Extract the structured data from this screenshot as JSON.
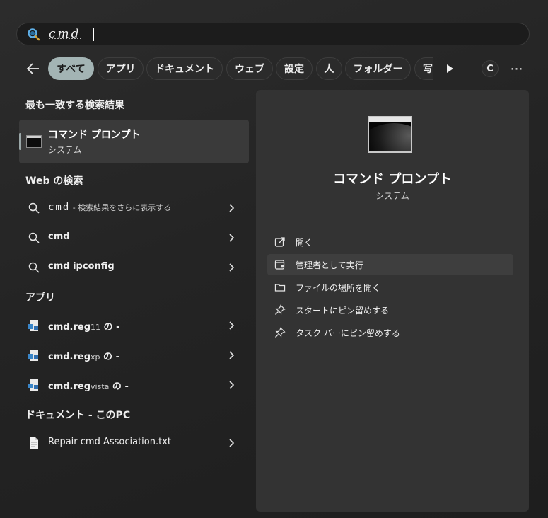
{
  "search": {
    "query": "cmd"
  },
  "filters": {
    "chips": [
      "すべて",
      "アプリ",
      "ドキュメント",
      "ウェブ",
      "設定",
      "人",
      "フォルダー",
      "写"
    ],
    "avatar_initial": "C",
    "more_label": "⋯"
  },
  "best_match": {
    "heading": "最も一致する検索結果",
    "title": "コマンド プロンプト",
    "subtitle": "システム"
  },
  "web": {
    "heading": "Web の検索",
    "items": [
      {
        "main": "cmd",
        "suffix": " - 検索結果をさらに表示する"
      },
      {
        "main": "cmd",
        "suffix": ""
      },
      {
        "main": "cmd ipconfig",
        "suffix": ""
      }
    ]
  },
  "apps": {
    "heading": "アプリ",
    "items": [
      {
        "main": "cmd.reg",
        "small": "11",
        "suffix": " の -"
      },
      {
        "main": "cmd.reg",
        "small": "xp",
        "suffix": " の -"
      },
      {
        "main": "cmd.reg",
        "small": "vista",
        "suffix": " の -"
      }
    ]
  },
  "documents": {
    "heading": "ドキュメント - このPC",
    "items": [
      {
        "main": "Repair cmd Association.txt"
      }
    ]
  },
  "detail": {
    "title": "コマンド プロンプト",
    "subtitle": "システム",
    "actions": [
      {
        "label": "開く",
        "icon": "open-icon"
      },
      {
        "label": "管理者として実行",
        "icon": "shield-run-icon"
      },
      {
        "label": "ファイルの場所を開く",
        "icon": "folder-icon"
      },
      {
        "label": "スタートにピン留めする",
        "icon": "pin-icon"
      },
      {
        "label": "タスク バーにピン留めする",
        "icon": "pin-icon"
      }
    ]
  },
  "colors": {
    "active_chip": "#a3b4b4",
    "search_icon": "#4ea8de"
  }
}
